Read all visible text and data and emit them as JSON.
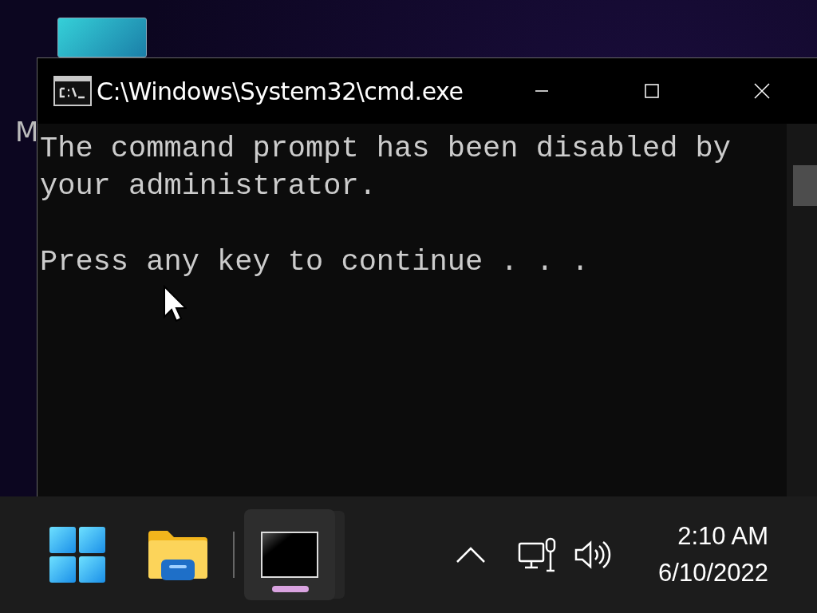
{
  "desktop": {
    "icon_label": "M"
  },
  "window": {
    "title": "C:\\Windows\\System32\\cmd.exe",
    "paragraphs": [
      "The command prompt has been disabled by your administrator.",
      "Press any key to continue . . ."
    ]
  },
  "taskbar": {
    "apps": [
      {
        "kind": "start",
        "selected": false
      },
      {
        "kind": "explorer",
        "selected": false
      },
      {
        "kind": "console",
        "selected": true
      }
    ],
    "clock": {
      "time": "2:10 AM",
      "date": "6/10/2022"
    }
  }
}
